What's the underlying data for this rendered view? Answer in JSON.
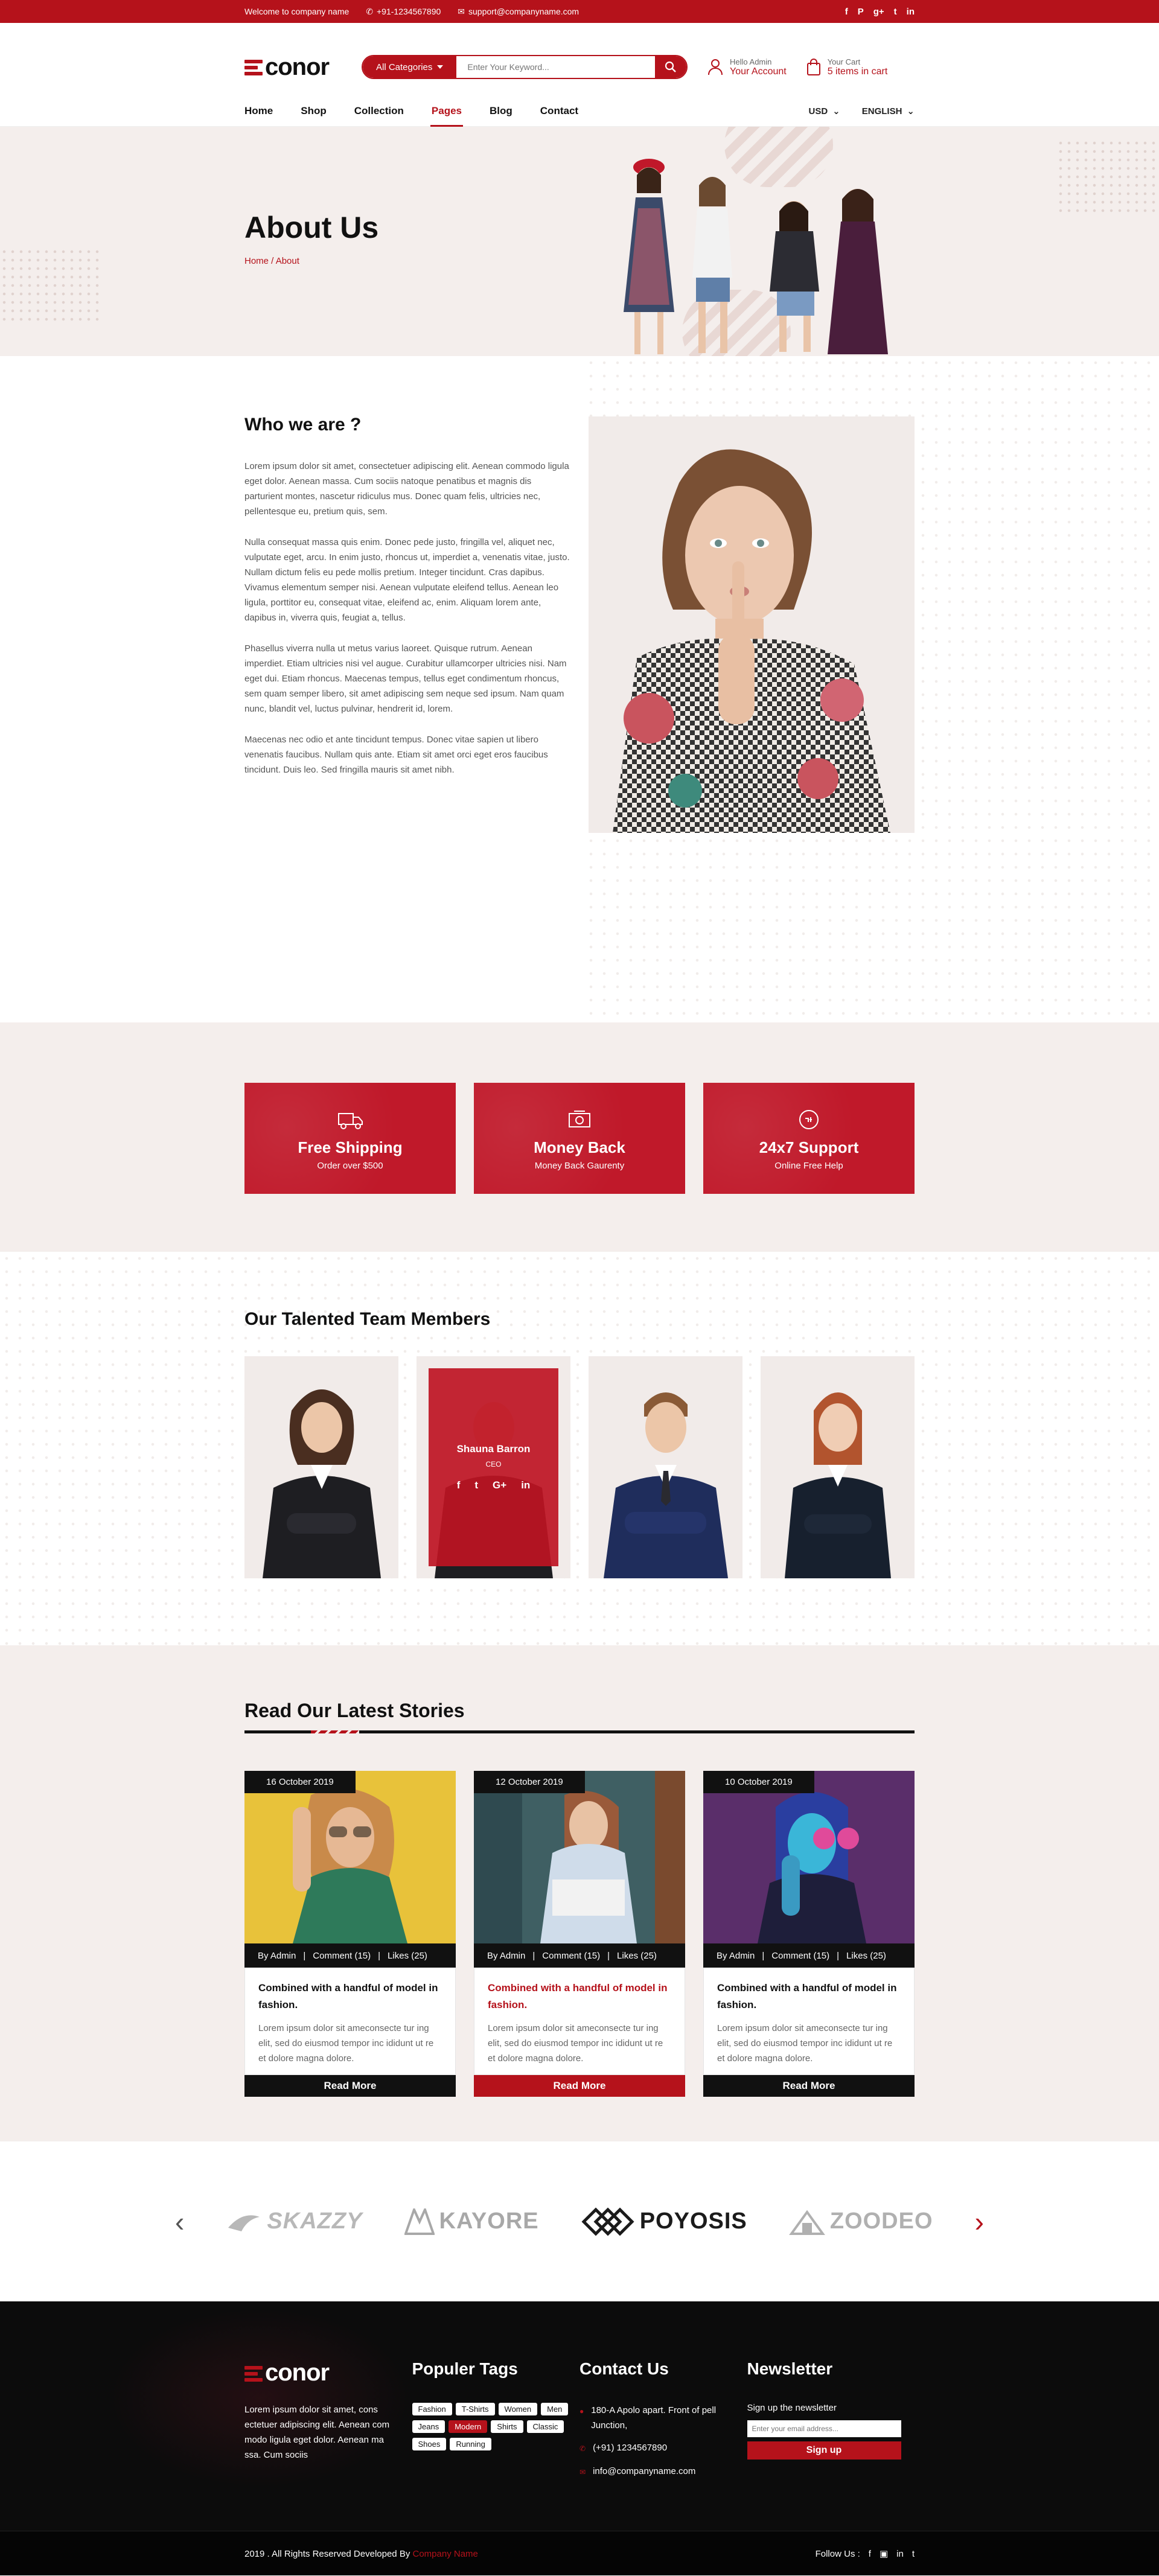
{
  "topbar": {
    "welcome": "Welcome to company name",
    "phone": "+91-1234567890",
    "email": "support@companyname.com",
    "social": [
      "f",
      "P",
      "g+",
      "t",
      "in"
    ]
  },
  "header": {
    "logo": "conor",
    "search_category": "All Categories",
    "search_placeholder": "Enter Your Keyword...",
    "account_greeting": "Hello Admin",
    "account_label": "Your Account",
    "cart_label": "Your Cart",
    "cart_count": "5 items in cart"
  },
  "nav": {
    "items": [
      "Home",
      "Shop",
      "Collection",
      "Pages",
      "Blog",
      "Contact"
    ],
    "active": "Pages",
    "currency": "USD",
    "language": "ENGLISH"
  },
  "banner": {
    "title": "About Us",
    "breadcrumb_home": "Home",
    "breadcrumb_sep": " / ",
    "breadcrumb_current": "About"
  },
  "who": {
    "title": "Who we are ?",
    "paragraphs": [
      "Lorem ipsum dolor sit amet, consectetuer adipiscing elit. Aenean commodo ligula eget dolor. Aenean massa. Cum sociis natoque penatibus et magnis dis parturient montes, nascetur ridiculus mus. Donec quam felis, ultricies nec, pellentesque eu, pretium quis, sem.",
      "Nulla consequat massa quis enim. Donec pede justo, fringilla vel, aliquet nec, vulputate eget, arcu. In enim justo, rhoncus ut, imperdiet a, venenatis vitae, justo. Nullam dictum felis eu pede mollis pretium. Integer tincidunt. Cras dapibus. Vivamus elementum semper nisi. Aenean vulputate eleifend tellus. Aenean leo ligula, porttitor eu, consequat vitae, eleifend ac, enim. Aliquam lorem ante, dapibus in, viverra quis, feugiat a, tellus.",
      "Phasellus viverra nulla ut metus varius laoreet. Quisque rutrum. Aenean imperdiet. Etiam ultricies nisi vel augue. Curabitur ullamcorper ultricies nisi. Nam eget dui. Etiam rhoncus. Maecenas tempus, tellus eget condimentum rhoncus, sem quam semper libero, sit amet adipiscing sem neque sed ipsum. Nam quam nunc, blandit vel, luctus pulvinar, hendrerit id, lorem.",
      "Maecenas nec odio et ante tincidunt tempus. Donec vitae sapien ut libero venenatis faucibus. Nullam quis ante. Etiam sit amet orci eget eros faucibus tincidunt. Duis leo. Sed fringilla mauris sit amet nibh."
    ]
  },
  "features": [
    {
      "title": "Free Shipping",
      "subtitle": "Order over $500",
      "icon": "truck-icon"
    },
    {
      "title": "Money Back",
      "subtitle": "Money Back Gaurenty",
      "icon": "money-icon"
    },
    {
      "title": "24x7 Support",
      "subtitle": "Online Free Help",
      "icon": "support-icon"
    }
  ],
  "team": {
    "title": "Our Talented Team Members",
    "featured_name": "Shauna Barron",
    "featured_role": "CEO",
    "social": [
      "f",
      "t",
      "G+",
      "in"
    ]
  },
  "stories": {
    "title": "Read Our Latest Stories",
    "posts": [
      {
        "date": "16 October 2019",
        "by": "By Admin",
        "comments": "Comment (15)",
        "likes": "Likes (25)",
        "title": "Combined with a handful of model in fashion.",
        "excerpt": "Lorem ipsum dolor sit ameconsecte tur ing elit, sed do eiusmod tempor inc ididunt ut re et dolore magna dolore.",
        "button": "Read More"
      },
      {
        "date": "12 October 2019",
        "by": "By Admin",
        "comments": "Comment (15)",
        "likes": "Likes (25)",
        "title": "Combined with a handful of model in fashion.",
        "excerpt": "Lorem ipsum dolor sit ameconsecte tur ing elit, sed do eiusmod tempor inc ididunt ut re et dolore magna dolore.",
        "button": "Read More"
      },
      {
        "date": "10 October 2019",
        "by": "By Admin",
        "comments": "Comment (15)",
        "likes": "Likes (25)",
        "title": "Combined with a handful of model in fashion.",
        "excerpt": "Lorem ipsum dolor sit ameconsecte tur ing elit, sed do eiusmod tempor inc ididunt ut re et dolore magna dolore.",
        "button": "Read More"
      }
    ]
  },
  "brands": [
    "SKAZZY",
    "KAYORE",
    "POYOSIS",
    "ZOODEO"
  ],
  "footer": {
    "logo": "conor",
    "about": "Lorem ipsum dolor sit amet, cons ectetuer adipiscing elit. Aenean com modo ligula eget dolor. Aenean ma ssa. Cum sociis",
    "tags_title": "Populer Tags",
    "tags": [
      "Fashion",
      "T-Shirts",
      "Women",
      "Men",
      "Jeans",
      "Modern",
      "Shirts",
      "Classic",
      "Shoes",
      "Running"
    ],
    "active_tag": "Modern",
    "contact_title": "Contact Us",
    "address": "180-A Apolo apart. Front of pell Junction,",
    "phone": "(+91) 1234567890",
    "email": "info@companyname.com",
    "newsletter_title": "Newsletter",
    "newsletter_text": "Sign up the newsletter",
    "newsletter_placeholder": "Enter your email address...",
    "newsletter_button": "Sign up",
    "copyright": "2019 . All Rights Reserved Developed By ",
    "company": "Company Name",
    "follow": "Follow Us :"
  },
  "colors": {
    "accent": "#b5121b",
    "dark": "#111111",
    "bg_light": "#f4eeec"
  }
}
